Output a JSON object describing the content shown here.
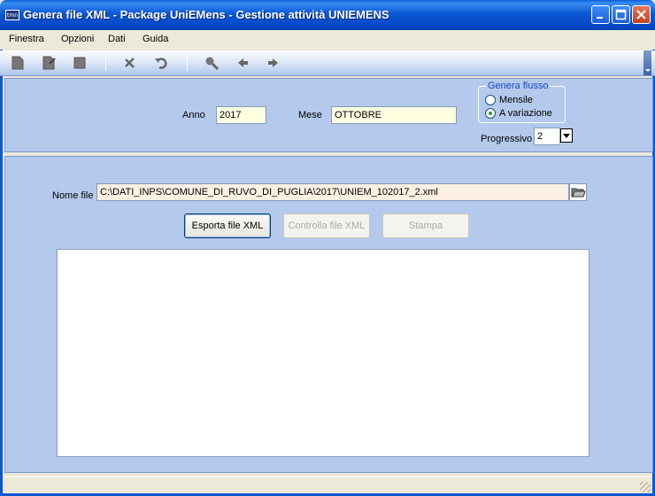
{
  "window": {
    "title": "Genera file XML - Package UniEMens - Gestione attività UNIEMENS",
    "icon_text": "tmn"
  },
  "menu": [
    "Finestra",
    "Opzioni",
    "Dati",
    "Guida"
  ],
  "toolbar": {
    "icons": [
      "new-icon",
      "edit-icon",
      "stop-icon",
      "delete-icon",
      "undo-icon",
      "search-icon",
      "arrow-left-icon",
      "arrow-right-icon"
    ]
  },
  "form": {
    "anno_label": "Anno",
    "anno_value": "2017",
    "mese_label": "Mese",
    "mese_value": "OTTOBRE",
    "genera_flusso": {
      "title": "Genera flusso",
      "options": [
        "Mensile",
        "A variazione"
      ],
      "selected": "A variazione"
    },
    "progressivo_label": "Progressivo",
    "progressivo_value": "2",
    "nome_file_label": "Nome file",
    "nome_file_value": "C:\\DATI_INPS\\COMUNE_DI_RUVO_DI_PUGLIA\\2017\\UNIEM_102017_2.xml"
  },
  "buttons": {
    "esporta": "Esporta file XML",
    "controlla": "Controlla file XML",
    "stampa": "Stampa"
  },
  "colors": {
    "titlebar": "#0b58d3",
    "panel": "#b4c9ec",
    "field_yellow": "#ffffe1",
    "field_orange": "#fcefe3"
  }
}
